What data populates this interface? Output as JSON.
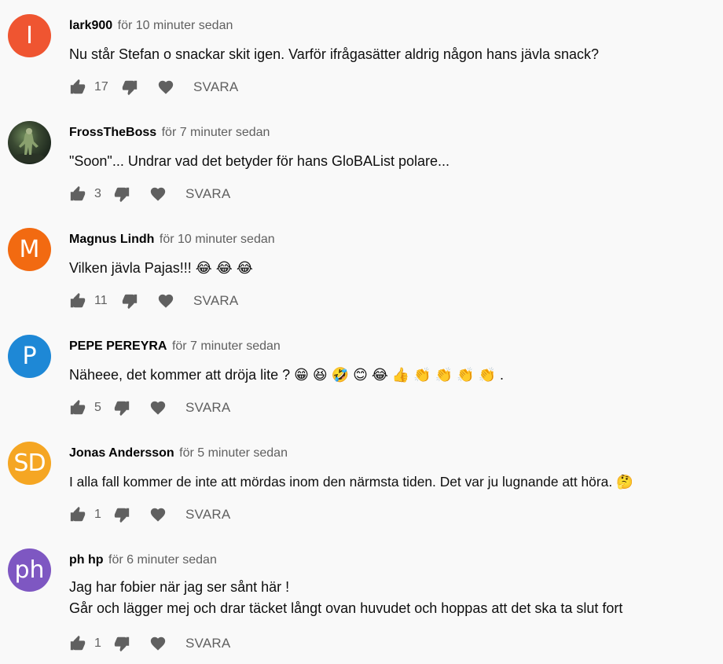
{
  "reply_label": "SVARA",
  "comments": [
    {
      "avatar_letter": "I",
      "avatar_color": "#ef5531",
      "author": "lark900",
      "time": "för 10 minuter sedan",
      "text_lines": [
        "Nu står Stefan o snackar skit igen. Varför ifrågasätter aldrig någon hans jävla snack?"
      ],
      "likes": "17"
    },
    {
      "avatar_letter": "",
      "avatar_color": "#2c3a2a",
      "author": "FrossTheBoss",
      "time": "för 7 minuter sedan",
      "text_lines": [
        "\"Soon\"... Undrar vad det betyder för hans GloBAList polare..."
      ],
      "likes": "3"
    },
    {
      "avatar_letter": "M",
      "avatar_color": "#f26a11",
      "author": "Magnus Lindh",
      "time": "för 10 minuter sedan",
      "text_lines": [
        "Vilken jävla Pajas!!! 😂 😂 😂"
      ],
      "likes": "11"
    },
    {
      "avatar_letter": "P",
      "avatar_color": "#1e88d6",
      "author": "PEPE PEREYRA",
      "time": "för 7 minuter sedan",
      "text_lines": [
        "Näheee, det kommer att dröja lite ? 😁 😆 🤣 😊 😂 👍 👏 👏 👏 👏 ."
      ],
      "likes": "5"
    },
    {
      "avatar_letter": "SD",
      "avatar_color": "#f5a623",
      "author": "Jonas Andersson",
      "time": "för 5 minuter sedan",
      "text_lines": [
        "I alla fall kommer de inte att mördas inom den närmsta tiden. Det var ju lugnande att höra. 🤔"
      ],
      "likes": "1"
    },
    {
      "avatar_letter": "ph",
      "avatar_color": "#7e57c2",
      "author": "ph hp",
      "time": "för 6 minuter sedan",
      "text_lines": [
        "Jag har fobier när jag ser sånt här !",
        "Går och lägger mej och drar täcket långt ovan huvudet och hoppas att det ska ta slut fort"
      ],
      "likes": "1"
    }
  ]
}
